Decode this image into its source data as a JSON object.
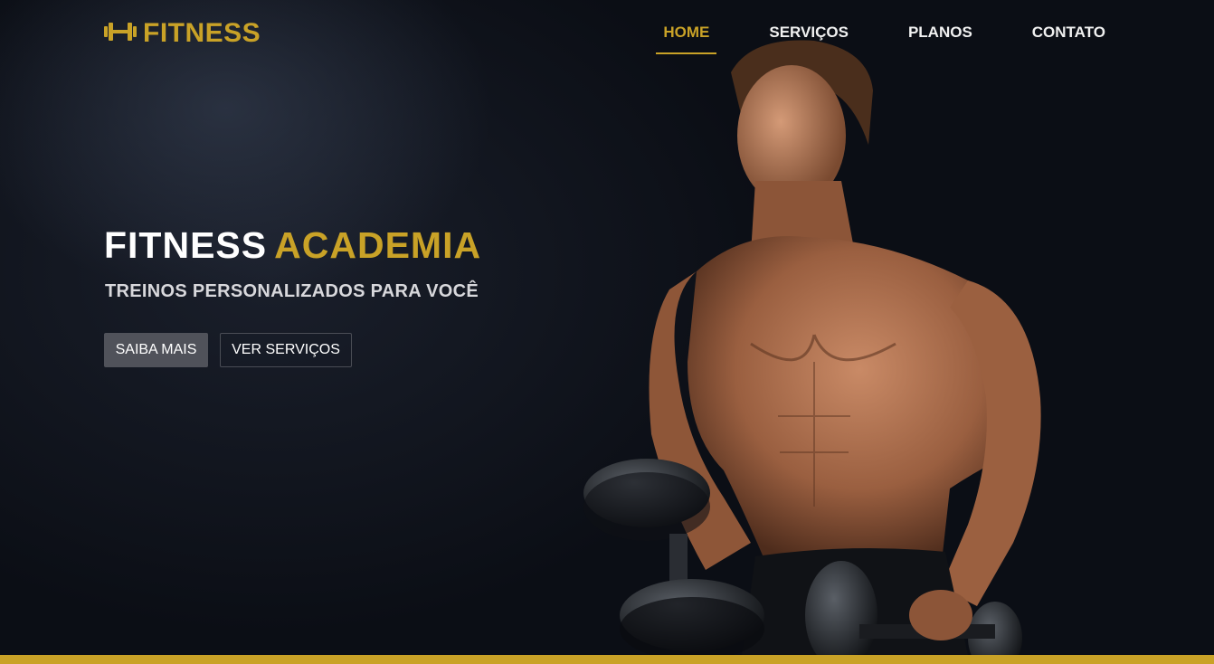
{
  "brand": {
    "name": "FITNESS",
    "accent": "#c9a227"
  },
  "nav": {
    "items": [
      {
        "label": "HOME",
        "active": true
      },
      {
        "label": "SERVIÇOS",
        "active": false
      },
      {
        "label": "PLANOS",
        "active": false
      },
      {
        "label": "CONTATO",
        "active": false
      }
    ]
  },
  "hero": {
    "title_part1": "FITNESS",
    "title_part2": "ACADEMIA",
    "subtitle": "TREINOS PERSONALIZADOS PARA VOCÊ",
    "primary_button": "SAIBA MAIS",
    "secondary_button": "VER SERVIÇOS"
  },
  "icons": {
    "logo": "dumbbell-icon"
  }
}
